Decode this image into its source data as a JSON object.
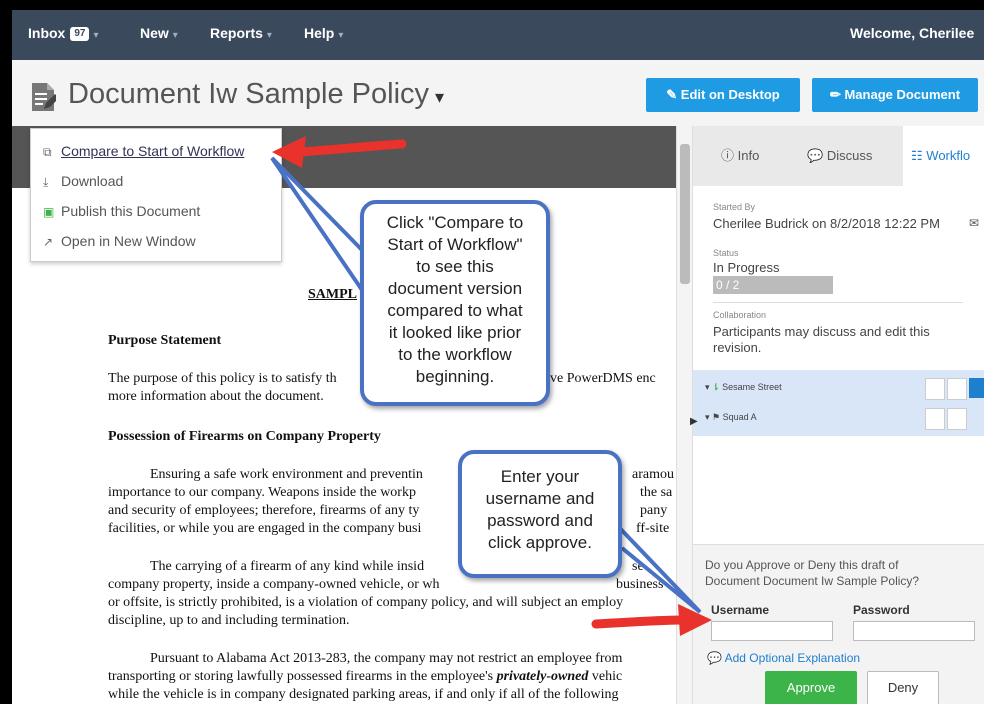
{
  "nav": {
    "inbox_label": "Inbox",
    "inbox_count": "97",
    "new_label": "New",
    "reports_label": "Reports",
    "help_label": "Help",
    "welcome": "Welcome, Cherilee"
  },
  "header": {
    "title": "Document Iw Sample Policy",
    "edit_desktop": "Edit on Desktop",
    "manage_document": "Manage Document"
  },
  "menu": {
    "items": [
      {
        "label": "Compare to Start of Workflow",
        "icon": "compare-icon"
      },
      {
        "label": "Download",
        "icon": "download-icon"
      },
      {
        "label": "Publish this Document",
        "icon": "publish-icon"
      },
      {
        "label": "Open in New Window",
        "icon": "external-link-icon"
      }
    ]
  },
  "document": {
    "heading": "SAMPL",
    "purpose_heading": "Purpose Statement",
    "purpose_line1": "The purpose of this policy is to satisfy th",
    "purpose_line1_end": "ve PowerDMS enc",
    "purpose_line2": "more information about the document.",
    "possession_heading": "Possession of Firearms on Company Property",
    "p1_l1": "Ensuring a safe work environment and preventin",
    "p1_l1_end": "aramou",
    "p1_l2": "importance to our company.  Weapons inside the workp",
    "p1_l2_end": "the sa",
    "p1_l3": "and security of employees; therefore, firearms of any ty",
    "p1_l3_end": "pany",
    "p1_l4": "facilities, or while you are engaged in the company busi",
    "p1_l4_end": "ff-site",
    "p2_l1": "The carrying of a firearm of any kind while insid",
    "p2_l1_end": "sed",
    "p2_l2": "company property, inside a company-owned vehicle, or wh",
    "p2_l2_end": "business",
    "p2_l3": "or offsite, is strictly prohibited, is a violation of company policy, and will subject an employ",
    "p2_l4": "discipline, up to and including termination.",
    "p3_l1": "Pursuant to Alabama Act 2013-283, the company may not restrict an employee from",
    "p3_l2a": "transporting or storing lawfully possessed firearms in the employee's ",
    "p3_l2b": "privately-owned",
    "p3_l2c": " vehic",
    "p3_l3": "while the vehicle is in company designated parking areas, if and only if all of the following"
  },
  "right_panel": {
    "tabs": [
      {
        "label": "Info"
      },
      {
        "label": "Discuss"
      },
      {
        "label": "Workflo"
      }
    ],
    "started_by_label": "Started By",
    "started_by_value": "Cherilee Budrick on 8/2/2018 12:22 PM",
    "status_label": "Status",
    "status_value": "In Progress",
    "progress_text": "0 / 2",
    "collab_label": "Collaboration",
    "collab_line1": "Participants may discuss and edit this",
    "collab_line2": "revision.",
    "tree": [
      {
        "label": "Sesame Street"
      },
      {
        "label": "Squad A"
      }
    ]
  },
  "approval": {
    "question_line1": "Do you Approve or Deny this draft of",
    "question_line2": "Document Document Iw Sample Policy?",
    "username_label": "Username",
    "password_label": "Password",
    "add_explanation": "Add Optional Explanation",
    "approve": "Approve",
    "deny": "Deny"
  },
  "callouts": {
    "compare": [
      "Click \"Compare to",
      "Start of Workflow\"",
      "to see this",
      "document version",
      "compared to what",
      "it looked like prior",
      "to the workflow",
      "beginning."
    ],
    "login": [
      "Enter your",
      "username and",
      "password and",
      "click approve."
    ]
  },
  "colors": {
    "nav_bg": "#3a4a5c",
    "accent_blue": "#1e9be3",
    "approve_green": "#3cb44a",
    "callout_border": "#4a72c4",
    "arrow_red": "#e8322b"
  }
}
